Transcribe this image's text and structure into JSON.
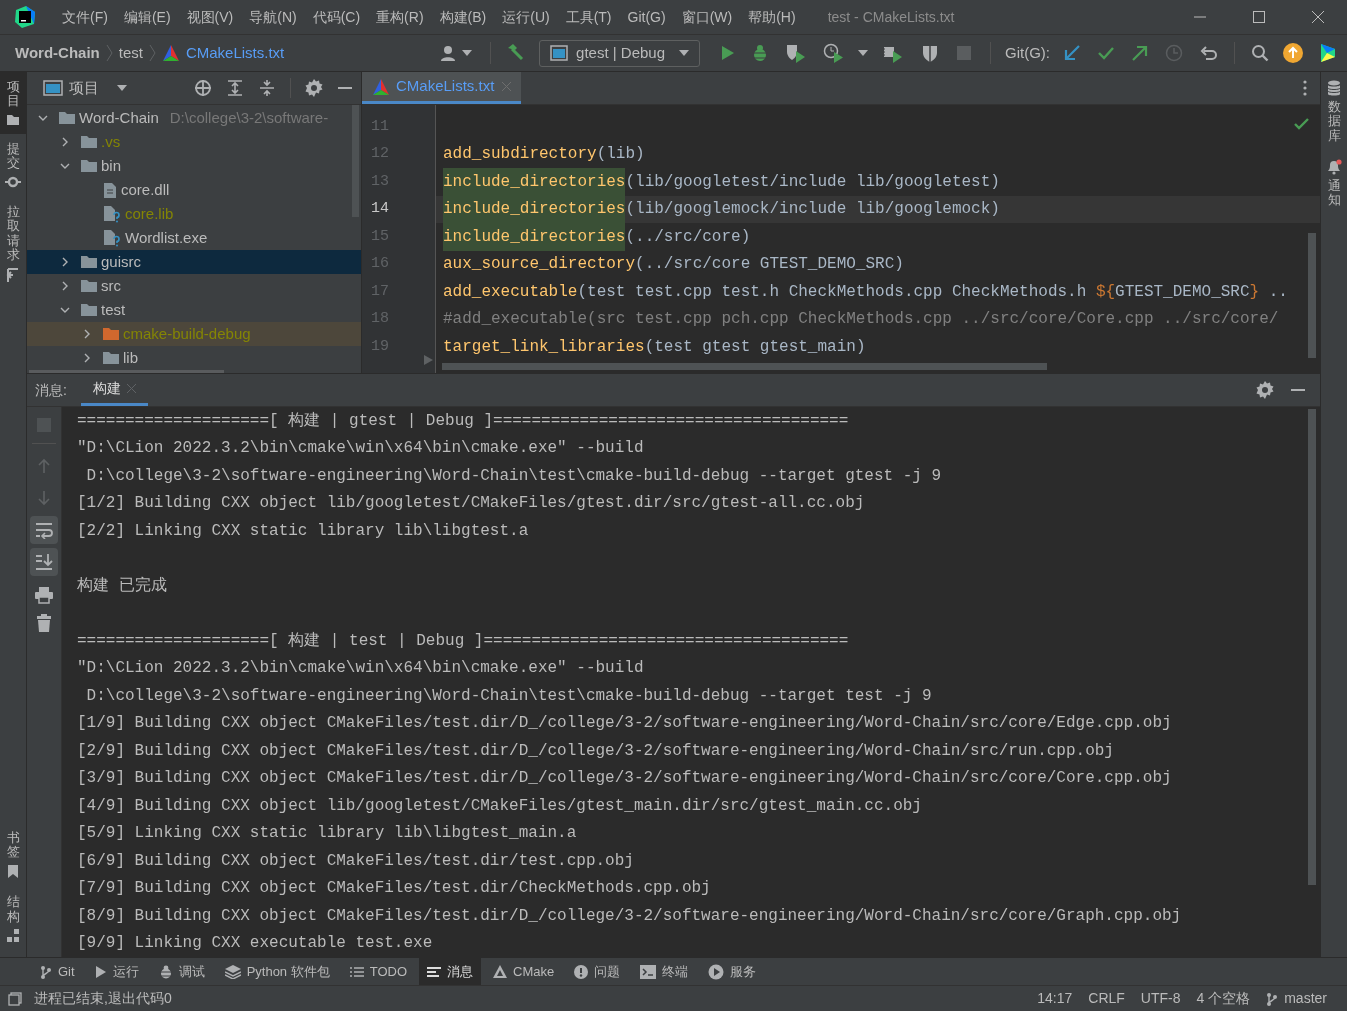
{
  "window": {
    "title": "test - CMakeLists.txt"
  },
  "menu": [
    "文件(F)",
    "编辑(E)",
    "视图(V)",
    "导航(N)",
    "代码(C)",
    "重构(R)",
    "构建(B)",
    "运行(U)",
    "工具(T)",
    "Git(G)",
    "窗口(W)",
    "帮助(H)"
  ],
  "breadcrumbs": [
    {
      "label": "Word-Chain",
      "kind": "project"
    },
    {
      "label": "test",
      "kind": "folder"
    },
    {
      "label": "CMakeLists.txt",
      "kind": "file"
    }
  ],
  "run_config": "gtest | Debug",
  "git_label": "Git(G):",
  "left_stripe": {
    "top": [
      {
        "label": "项目",
        "selected": true
      },
      {
        "label": "提交",
        "selected": false
      },
      {
        "label": "拉取请求",
        "selected": false
      }
    ],
    "bottom": [
      {
        "label": "书签",
        "selected": false
      },
      {
        "label": "结构",
        "selected": false
      }
    ]
  },
  "right_stripe": [
    {
      "label": "数据库",
      "selected": false
    },
    {
      "label": "通知",
      "selected": false
    }
  ],
  "project_panel": {
    "title": "项目",
    "tree": [
      {
        "label": "Word-Chain",
        "kind": "folder",
        "path": "D:\\college\\3-2\\software-",
        "expanded": true,
        "selected": false,
        "ignored": false,
        "children": [
          {
            "label": ".vs",
            "kind": "folder",
            "expanded": false,
            "selected": false,
            "ignored": true
          },
          {
            "label": "bin",
            "kind": "folder",
            "expanded": true,
            "selected": false,
            "ignored": false,
            "children": [
              {
                "label": "core.dll",
                "kind": "file",
                "selected": false,
                "ignored": false
              },
              {
                "label": "core.lib",
                "kind": "unknown-file",
                "selected": false,
                "ignored": true
              },
              {
                "label": "Wordlist.exe",
                "kind": "unknown-file",
                "selected": false,
                "ignored": false
              }
            ]
          },
          {
            "label": "guisrc",
            "kind": "folder",
            "expanded": false,
            "selected": true,
            "ignored": false
          },
          {
            "label": "src",
            "kind": "folder",
            "expanded": false,
            "selected": false,
            "ignored": false
          },
          {
            "label": "test",
            "kind": "folder",
            "expanded": true,
            "selected": false,
            "ignored": false,
            "children": [
              {
                "label": "cmake-build-debug",
                "kind": "excluded-folder",
                "expanded": false,
                "selected": false,
                "ignored": true
              },
              {
                "label": "lib",
                "kind": "folder",
                "expanded": false,
                "selected": false,
                "ignored": false
              }
            ]
          }
        ]
      }
    ]
  },
  "editor": {
    "tabs": [
      {
        "label": "CMakeLists.txt",
        "selected": true
      }
    ],
    "lines": [
      {
        "number": "11",
        "current": false
      },
      {
        "number": "12",
        "current": false,
        "segments": [
          {
            "text": "add_subdirectory",
            "kind": "function",
            "highlighted": false
          },
          {
            "text": "(lib)",
            "kind": "plain",
            "highlighted": false
          }
        ]
      },
      {
        "number": "13",
        "current": false,
        "segments": [
          {
            "text": "include_directories",
            "kind": "function",
            "highlighted": true
          },
          {
            "text": "(lib/googletest/include lib/googletest)",
            "kind": "plain",
            "highlighted": false
          }
        ]
      },
      {
        "number": "14",
        "current": true,
        "segments": [
          {
            "text": "include_directories",
            "kind": "function",
            "highlighted": true
          },
          {
            "text": "(lib/googlemock/include lib/googlemock)",
            "kind": "plain",
            "highlighted": false
          }
        ]
      },
      {
        "number": "15",
        "current": false,
        "segments": [
          {
            "text": "include_directories",
            "kind": "function",
            "highlighted": true
          },
          {
            "text": "(../src/core)",
            "kind": "plain",
            "highlighted": false
          }
        ]
      },
      {
        "number": "16",
        "current": false,
        "segments": [
          {
            "text": "aux_source_directory",
            "kind": "function",
            "highlighted": false
          },
          {
            "text": "(../src/core GTEST_DEMO_SRC)",
            "kind": "plain",
            "highlighted": false
          }
        ]
      },
      {
        "number": "17",
        "current": false,
        "segments": [
          {
            "text": "add_executable",
            "kind": "function",
            "highlighted": false
          },
          {
            "text": "(test test.cpp test.h CheckMethods.cpp CheckMethods.h ",
            "kind": "plain",
            "highlighted": false
          },
          {
            "text": "${",
            "kind": "keyword",
            "highlighted": false
          },
          {
            "text": "GTEST_DEMO_SRC",
            "kind": "plain",
            "highlighted": false
          },
          {
            "text": "}",
            "kind": "keyword",
            "highlighted": false
          },
          {
            "text": " ..",
            "kind": "plain",
            "highlighted": false
          }
        ]
      },
      {
        "number": "18",
        "current": false,
        "segments": [
          {
            "text": "#add_executable(src test.cpp pch.cpp CheckMethods.cpp ../src/core/Core.cpp ../src/core/",
            "kind": "comment",
            "highlighted": false
          }
        ]
      },
      {
        "number": "19",
        "current": false,
        "segments": [
          {
            "text": "target_link_libraries",
            "kind": "function",
            "highlighted": false
          },
          {
            "text": "(test gtest gtest_main)",
            "kind": "plain",
            "highlighted": false
          }
        ]
      }
    ]
  },
  "build_panel": {
    "label": "消息:",
    "tabs": [
      {
        "label": "构建",
        "selected": true
      }
    ],
    "output": [
      [
        "====================[ 构建 | gtest | Debug ]=====================================",
        "\"D:\\CLion 2022.3.2\\bin\\cmake\\win\\x64\\bin\\cmake.exe\" --build",
        " D:\\college\\3-2\\software-engineering\\Word-Chain\\test\\cmake-build-debug --target gtest -j 9",
        "[1/2] Building CXX object lib/googletest/CMakeFiles/gtest.dir/src/gtest-all.cc.obj",
        "[2/2] Linking CXX static library lib\\libgtest.a"
      ],
      [
        "构建 已完成"
      ],
      [
        "====================[ 构建 | test | Debug ]======================================",
        "\"D:\\CLion 2022.3.2\\bin\\cmake\\win\\x64\\bin\\cmake.exe\" --build",
        " D:\\college\\3-2\\software-engineering\\Word-Chain\\test\\cmake-build-debug --target test -j 9",
        "[1/9] Building CXX object CMakeFiles/test.dir/D_/college/3-2/software-engineering/Word-Chain/src/core/Edge.cpp.obj",
        "[2/9] Building CXX object CMakeFiles/test.dir/D_/college/3-2/software-engineering/Word-Chain/src/run.cpp.obj",
        "[3/9] Building CXX object CMakeFiles/test.dir/D_/college/3-2/software-engineering/Word-Chain/src/core/Core.cpp.obj",
        "[4/9] Building CXX object lib/googletest/CMakeFiles/gtest_main.dir/src/gtest_main.cc.obj",
        "[5/9] Linking CXX static library lib\\libgtest_main.a",
        "[6/9] Building CXX object CMakeFiles/test.dir/test.cpp.obj",
        "[7/9] Building CXX object CMakeFiles/test.dir/CheckMethods.cpp.obj",
        "[8/9] Building CXX object CMakeFiles/test.dir/D_/college/3-2/software-engineering/Word-Chain/src/core/Graph.cpp.obj",
        "[9/9] Linking CXX executable test.exe"
      ]
    ]
  },
  "tool_windows": [
    {
      "label": "Git",
      "selected": false
    },
    {
      "label": "运行",
      "selected": false
    },
    {
      "label": "调试",
      "selected": false
    },
    {
      "label": "Python 软件包",
      "selected": false
    },
    {
      "label": "TODO",
      "selected": false
    },
    {
      "label": "消息",
      "selected": true
    },
    {
      "label": "CMake",
      "selected": false
    },
    {
      "label": "问题",
      "selected": false
    },
    {
      "label": "终端",
      "selected": false
    },
    {
      "label": "服务",
      "selected": false
    }
  ],
  "status_bar": {
    "message": "进程已结束,退出代码0",
    "items": [
      "14:17",
      "CRLF",
      "UTF-8",
      "4 个空格",
      "master"
    ]
  }
}
